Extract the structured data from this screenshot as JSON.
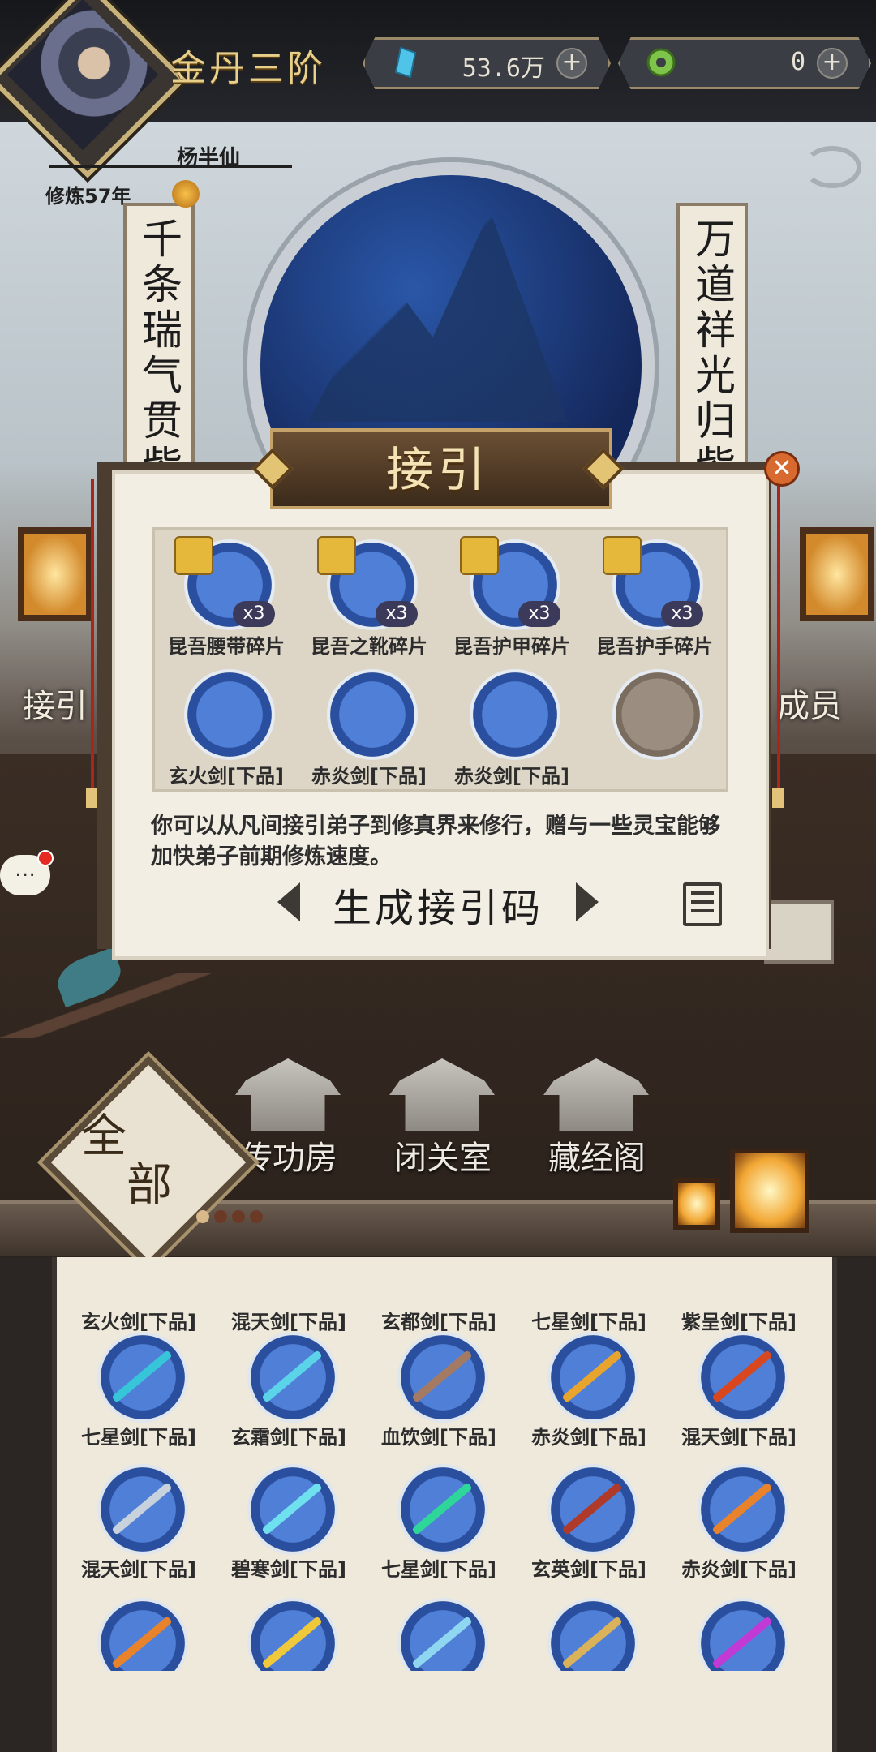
{
  "top": {
    "realm": "金丹三阶",
    "spirit_stone": "53.6万",
    "jade": "0",
    "player_name": "杨半仙",
    "cultivation": "修炼57年"
  },
  "scene": {
    "couplet_left": "千条瑞气贯紫",
    "couplet_right": "万道祥光归紫",
    "side_left": "接引",
    "side_right": "成员",
    "chat": "…"
  },
  "modal": {
    "title": "接引",
    "close": "✕",
    "rewards": [
      {
        "label": "昆吾腰带碎片",
        "count": "x3"
      },
      {
        "label": "昆吾之靴碎片",
        "count": "x3"
      },
      {
        "label": "昆吾护甲碎片",
        "count": "x3"
      },
      {
        "label": "昆吾护手碎片",
        "count": "x3"
      },
      {
        "label": "玄火剑[下品]"
      },
      {
        "label": "赤炎剑[下品]"
      },
      {
        "label": "赤炎剑[下品]"
      },
      {
        "label": ""
      }
    ],
    "description": "你可以从凡间接引弟子到修真界来修行，赠与一些灵宝能够加快弟子前期修炼速度。",
    "generate_button": "生成接引码"
  },
  "buildings": [
    "传功房",
    "闭关室",
    "藏经阁"
  ],
  "all_tab": [
    "全",
    "部"
  ],
  "grid": {
    "partial_row": [
      "玄火剑[下品]",
      "混天剑[下品]",
      "玄都剑[下品]",
      "七星剑[下品]",
      "紫呈剑[下品]"
    ],
    "rows": [
      [
        "七星剑[下品]",
        "玄霜剑[下品]",
        "血饮剑[下品]",
        "赤炎剑[下品]",
        "混天剑[下品]"
      ],
      [
        "混天剑[下品]",
        "碧寒剑[下品]",
        "七星剑[下品]",
        "玄英剑[下品]",
        "赤炎剑[下品]"
      ],
      [
        "",
        "",
        "",
        "",
        ""
      ]
    ]
  },
  "colors": {
    "accent_gold": "#e8cf8a",
    "sword_red": "#d9471e",
    "sword_cyan": "#37c6d9",
    "sword_purple": "#c23ad6",
    "sword_gold": "#e8a42c"
  }
}
